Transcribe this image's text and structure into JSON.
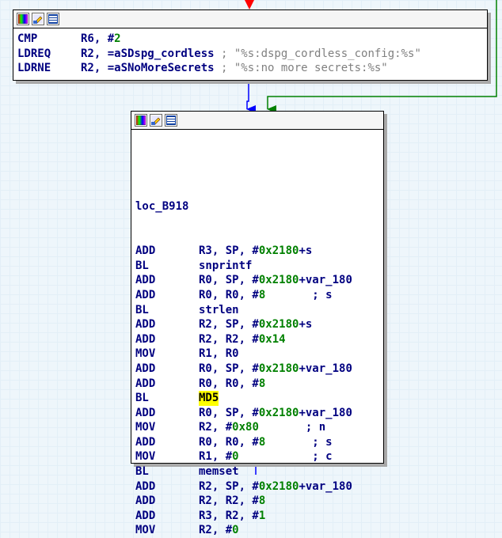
{
  "toolbar_icons": [
    "color-palette-icon",
    "edit-node-icon",
    "graph-view-icon"
  ],
  "node_top": {
    "lines": [
      {
        "mnemonic": "CMP",
        "parts": [
          {
            "t": "R6, ",
            "c": "reg"
          },
          {
            "t": "#",
            "c": "reg"
          },
          {
            "t": "2",
            "c": "num"
          }
        ]
      },
      {
        "mnemonic": "LDREQ",
        "parts": [
          {
            "t": "R2, =aSDspg_cordless",
            "c": "reg"
          },
          {
            "t": " ; \"%s:dspg_cordless_config:%s\"",
            "c": "cmt"
          }
        ]
      },
      {
        "mnemonic": "LDRNE",
        "parts": [
          {
            "t": "R2, =aSNoMoreSecrets",
            "c": "reg"
          },
          {
            "t": " ; \"%s:no more secrets:%s\"",
            "c": "cmt"
          }
        ]
      }
    ]
  },
  "node_main": {
    "label": "loc_B918",
    "lines": [
      {
        "mnemonic": "ADD",
        "parts": [
          {
            "t": "R3, SP, #",
            "c": "reg"
          },
          {
            "t": "0x2180",
            "c": "num"
          },
          {
            "t": "+s",
            "c": "reg"
          }
        ]
      },
      {
        "mnemonic": "BL",
        "parts": [
          {
            "t": "snprintf",
            "c": "name"
          }
        ]
      },
      {
        "mnemonic": "ADD",
        "parts": [
          {
            "t": "R0, SP, #",
            "c": "reg"
          },
          {
            "t": "0x2180",
            "c": "num"
          },
          {
            "t": "+var_180",
            "c": "reg"
          }
        ]
      },
      {
        "mnemonic": "ADD",
        "parts": [
          {
            "t": "R0, R0, #",
            "c": "reg"
          },
          {
            "t": "8",
            "c": "num"
          },
          {
            "t": "       ; s",
            "c": "reg"
          }
        ]
      },
      {
        "mnemonic": "BL",
        "parts": [
          {
            "t": "strlen",
            "c": "name"
          }
        ]
      },
      {
        "mnemonic": "ADD",
        "parts": [
          {
            "t": "R2, SP, #",
            "c": "reg"
          },
          {
            "t": "0x2180",
            "c": "num"
          },
          {
            "t": "+s",
            "c": "reg"
          }
        ]
      },
      {
        "mnemonic": "ADD",
        "parts": [
          {
            "t": "R2, R2, #",
            "c": "reg"
          },
          {
            "t": "0x14",
            "c": "num"
          }
        ]
      },
      {
        "mnemonic": "MOV",
        "parts": [
          {
            "t": "R1, R0",
            "c": "reg"
          }
        ]
      },
      {
        "mnemonic": "ADD",
        "parts": [
          {
            "t": "R0, SP, #",
            "c": "reg"
          },
          {
            "t": "0x2180",
            "c": "num"
          },
          {
            "t": "+var_180",
            "c": "reg"
          }
        ]
      },
      {
        "mnemonic": "ADD",
        "parts": [
          {
            "t": "R0, R0, #",
            "c": "reg"
          },
          {
            "t": "8",
            "c": "num"
          }
        ]
      },
      {
        "mnemonic": "BL",
        "parts": [
          {
            "t": "MD5",
            "c": "hl"
          }
        ]
      },
      {
        "mnemonic": "ADD",
        "parts": [
          {
            "t": "R0, SP, #",
            "c": "reg"
          },
          {
            "t": "0x2180",
            "c": "num"
          },
          {
            "t": "+var_180",
            "c": "reg"
          }
        ]
      },
      {
        "mnemonic": "MOV",
        "parts": [
          {
            "t": "R2, #",
            "c": "reg"
          },
          {
            "t": "0x80",
            "c": "num"
          },
          {
            "t": "       ; n",
            "c": "reg"
          }
        ]
      },
      {
        "mnemonic": "ADD",
        "parts": [
          {
            "t": "R0, R0, #",
            "c": "reg"
          },
          {
            "t": "8",
            "c": "num"
          },
          {
            "t": "       ; s",
            "c": "reg"
          }
        ]
      },
      {
        "mnemonic": "MOV",
        "parts": [
          {
            "t": "R1, #",
            "c": "reg"
          },
          {
            "t": "0",
            "c": "num"
          },
          {
            "t": "           ; c",
            "c": "reg"
          }
        ]
      },
      {
        "mnemonic": "BL",
        "parts": [
          {
            "t": "memset",
            "c": "name"
          }
        ]
      },
      {
        "mnemonic": "ADD",
        "parts": [
          {
            "t": "R2, SP, #",
            "c": "reg"
          },
          {
            "t": "0x2180",
            "c": "num"
          },
          {
            "t": "+var_180",
            "c": "reg"
          }
        ]
      },
      {
        "mnemonic": "ADD",
        "parts": [
          {
            "t": "R2, R2, #",
            "c": "reg"
          },
          {
            "t": "8",
            "c": "num"
          }
        ]
      },
      {
        "mnemonic": "ADD",
        "parts": [
          {
            "t": "R3, R2, #",
            "c": "reg"
          },
          {
            "t": "1",
            "c": "num"
          }
        ]
      },
      {
        "mnemonic": "MOV",
        "parts": [
          {
            "t": "R2, #",
            "c": "reg"
          },
          {
            "t": "0",
            "c": "num"
          }
        ]
      }
    ]
  },
  "colors": {
    "edge_red": "#ff0000",
    "edge_blue": "#0000ff",
    "edge_green": "#008000",
    "highlight": "#ffff00"
  }
}
